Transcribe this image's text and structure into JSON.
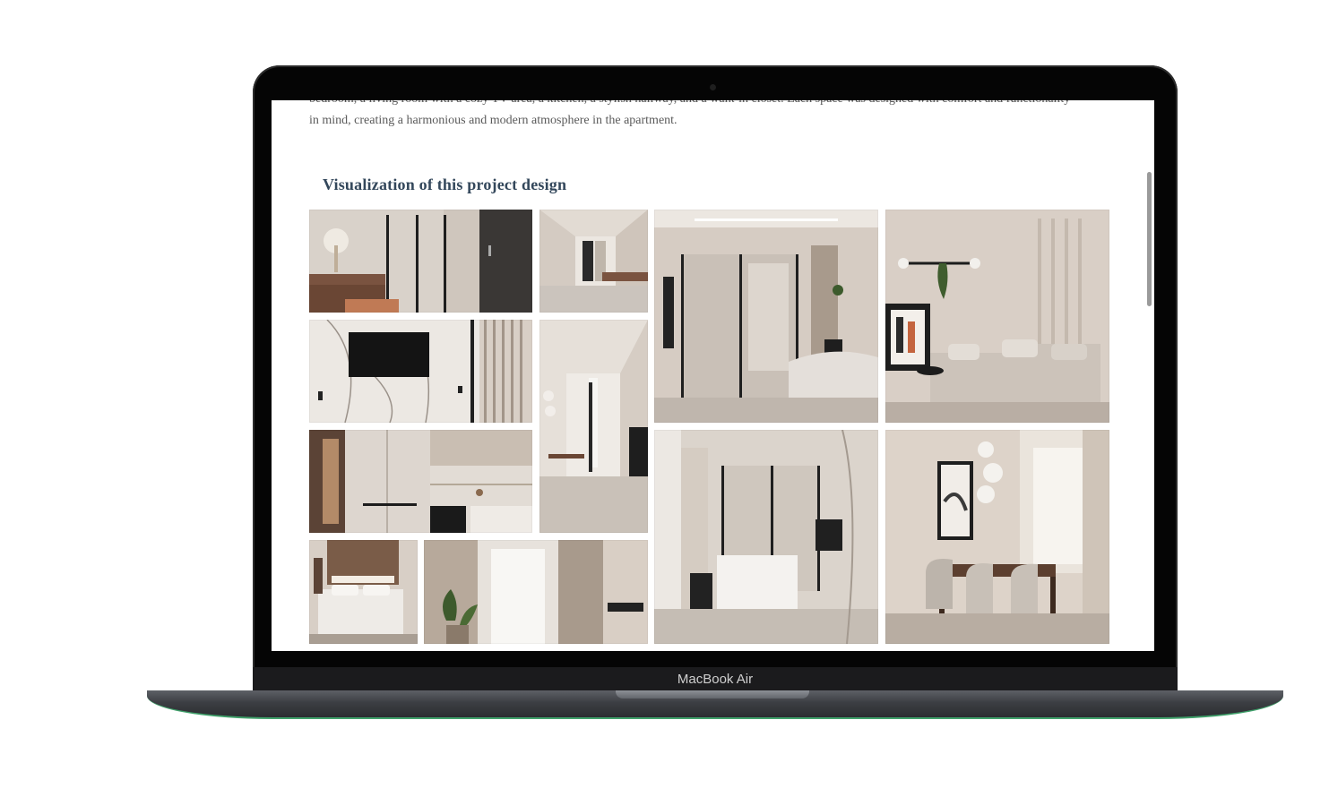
{
  "article": {
    "paragraph_lines": [
      "bedroom, a living room with a cozy TV area, a kitchen, a stylish hallway, and a walk-in closet. Each space was designed with comfort and functionality",
      "in mind, creating a harmonious and modern atmosphere in the apartment."
    ],
    "gallery_heading": "Visualization of this project design"
  },
  "device": {
    "label": "MacBook Air"
  },
  "gallery": {
    "photos": [
      {
        "name": "hallway-console-photo",
        "icon": "interior-photo"
      },
      {
        "name": "hallway-corridor-photo",
        "icon": "interior-photo"
      },
      {
        "name": "living-room-glass-door-photo",
        "icon": "interior-photo"
      },
      {
        "name": "living-room-sofa-photo",
        "icon": "interior-photo"
      },
      {
        "name": "tv-marble-wall-photo",
        "icon": "interior-photo"
      },
      {
        "name": "corridor-dining-view-photo",
        "icon": "interior-photo"
      },
      {
        "name": "kitchen-wardrobe-photo",
        "icon": "interior-photo"
      },
      {
        "name": "kitchen-glass-partition-photo",
        "icon": "interior-photo"
      },
      {
        "name": "dining-room-photo",
        "icon": "interior-photo"
      },
      {
        "name": "bedroom-photo",
        "icon": "interior-photo"
      },
      {
        "name": "bedroom-window-curtains-photo",
        "icon": "interior-photo"
      }
    ]
  },
  "colors": {
    "heading": "#33475b",
    "body_text": "#5a5a5a",
    "beige_wall": "#d8cdc5",
    "wood": "#6b4a3a",
    "dark_accent": "#1c1c1c"
  }
}
